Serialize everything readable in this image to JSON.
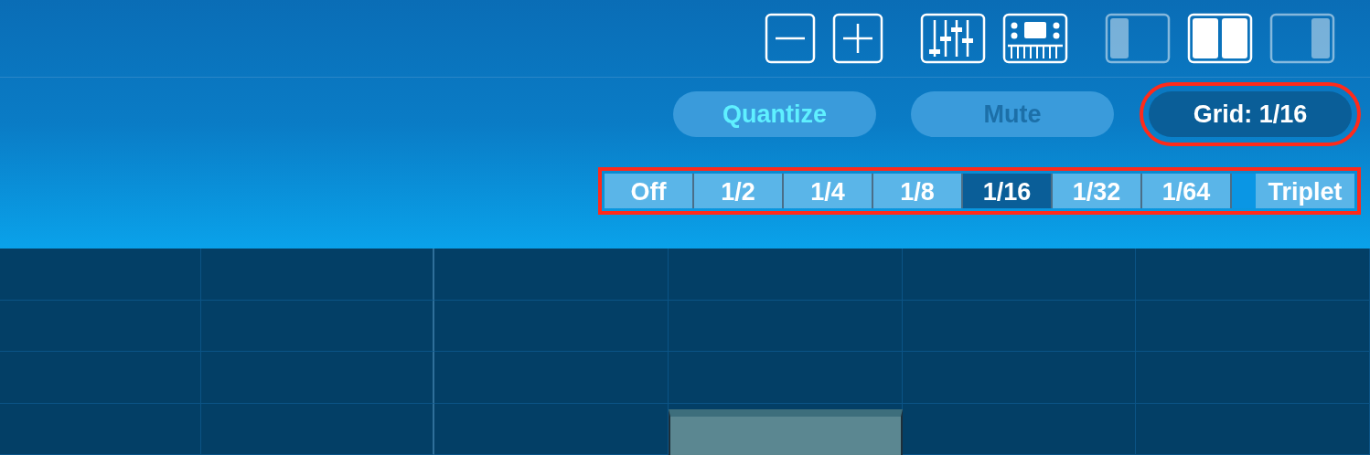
{
  "toolbar": {
    "zoom_buttons": [
      {
        "kind": "minus"
      },
      {
        "kind": "plus"
      }
    ],
    "tool_buttons": [
      {
        "kind": "mixer"
      },
      {
        "kind": "keyboard"
      }
    ],
    "view_buttons": [
      {
        "kind": "left",
        "selected": false
      },
      {
        "kind": "both",
        "selected": true
      },
      {
        "kind": "right",
        "selected": false
      }
    ]
  },
  "actions": [
    {
      "label": "Quantize",
      "kind": "quantize",
      "disabled": false,
      "highlighted": false
    },
    {
      "label": "Mute",
      "kind": "mute",
      "disabled": true,
      "highlighted": false
    },
    {
      "label": "Grid: 1/16",
      "kind": "grid",
      "disabled": false,
      "highlighted": true
    }
  ],
  "grid_options": {
    "highlighted": true,
    "items": [
      {
        "label": "Off",
        "selected": false
      },
      {
        "label": "1/2",
        "selected": false
      },
      {
        "label": "1/4",
        "selected": false
      },
      {
        "label": "1/8",
        "selected": false
      },
      {
        "label": "1/16",
        "selected": true
      },
      {
        "label": "1/32",
        "selected": false
      },
      {
        "label": "1/64",
        "selected": false
      }
    ],
    "triplet": {
      "label": "Triplet",
      "selected": false
    }
  }
}
